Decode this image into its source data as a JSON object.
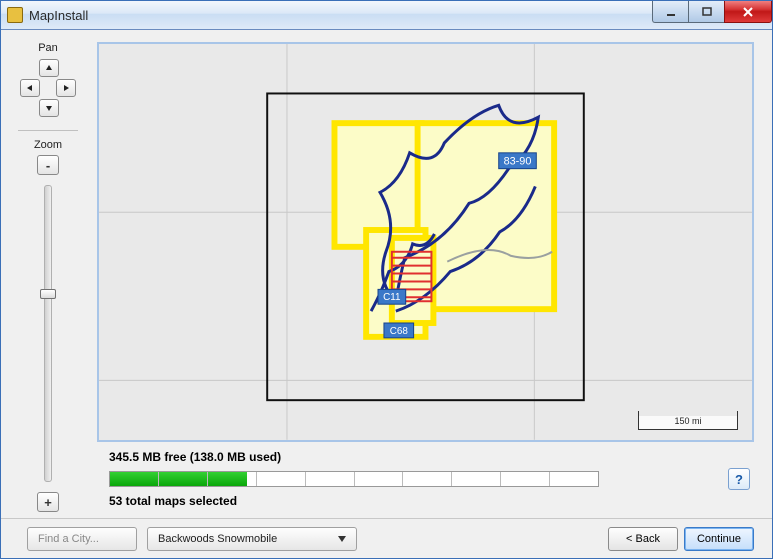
{
  "window": {
    "title": "MapInstall"
  },
  "panels": {
    "pan_label": "Pan",
    "zoom_label": "Zoom"
  },
  "map": {
    "scale_label": "150 mi",
    "tile_labels": {
      "a": "83-90",
      "b": "C11",
      "c": "C68"
    }
  },
  "status": {
    "free_text": "345.5 MB free (138.0 MB used)",
    "progress_pct": 28,
    "selected_text": "53 total maps selected"
  },
  "bottom": {
    "find_placeholder": "Find a City...",
    "dropdown_value": "Backwoods Snowmobile",
    "back_label": "< Back",
    "continue_label": "Continue"
  }
}
